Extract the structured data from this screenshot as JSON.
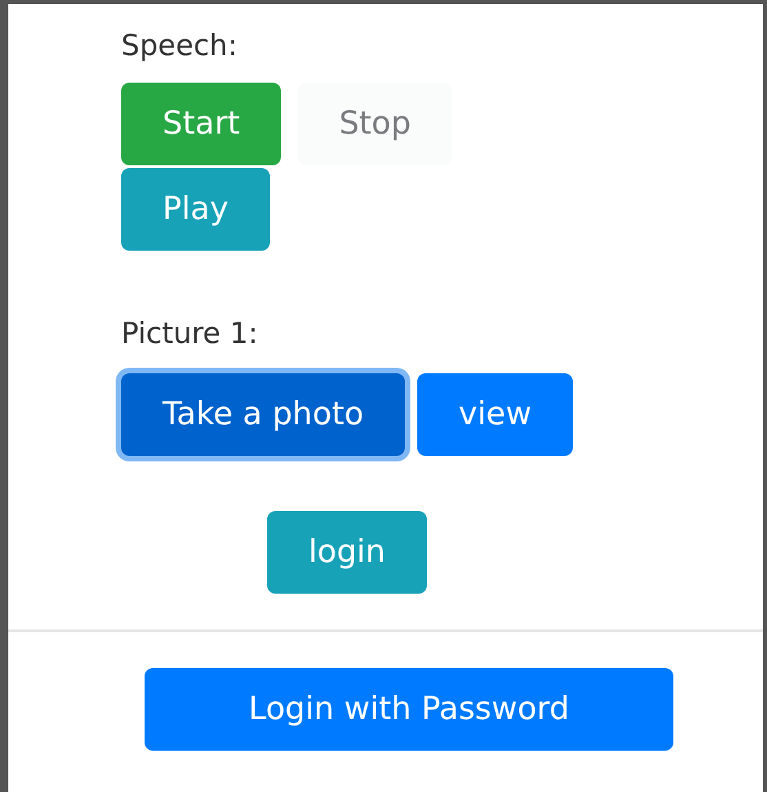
{
  "speech": {
    "label": "Speech:",
    "buttons": [
      {
        "label": "Start",
        "kind": "success",
        "disabled": false
      },
      {
        "label": "Stop",
        "kind": "light",
        "disabled": true
      },
      {
        "label": "Play",
        "kind": "info",
        "disabled": false
      }
    ]
  },
  "picture": {
    "label": "Picture 1:",
    "buttons": [
      {
        "label": "Take a photo",
        "kind": "primary",
        "focused": true
      },
      {
        "label": "view",
        "kind": "primary",
        "focused": false
      }
    ]
  },
  "login_button": {
    "label": "login",
    "kind": "info"
  },
  "password_button": {
    "label": "Login with Password",
    "kind": "primary"
  }
}
